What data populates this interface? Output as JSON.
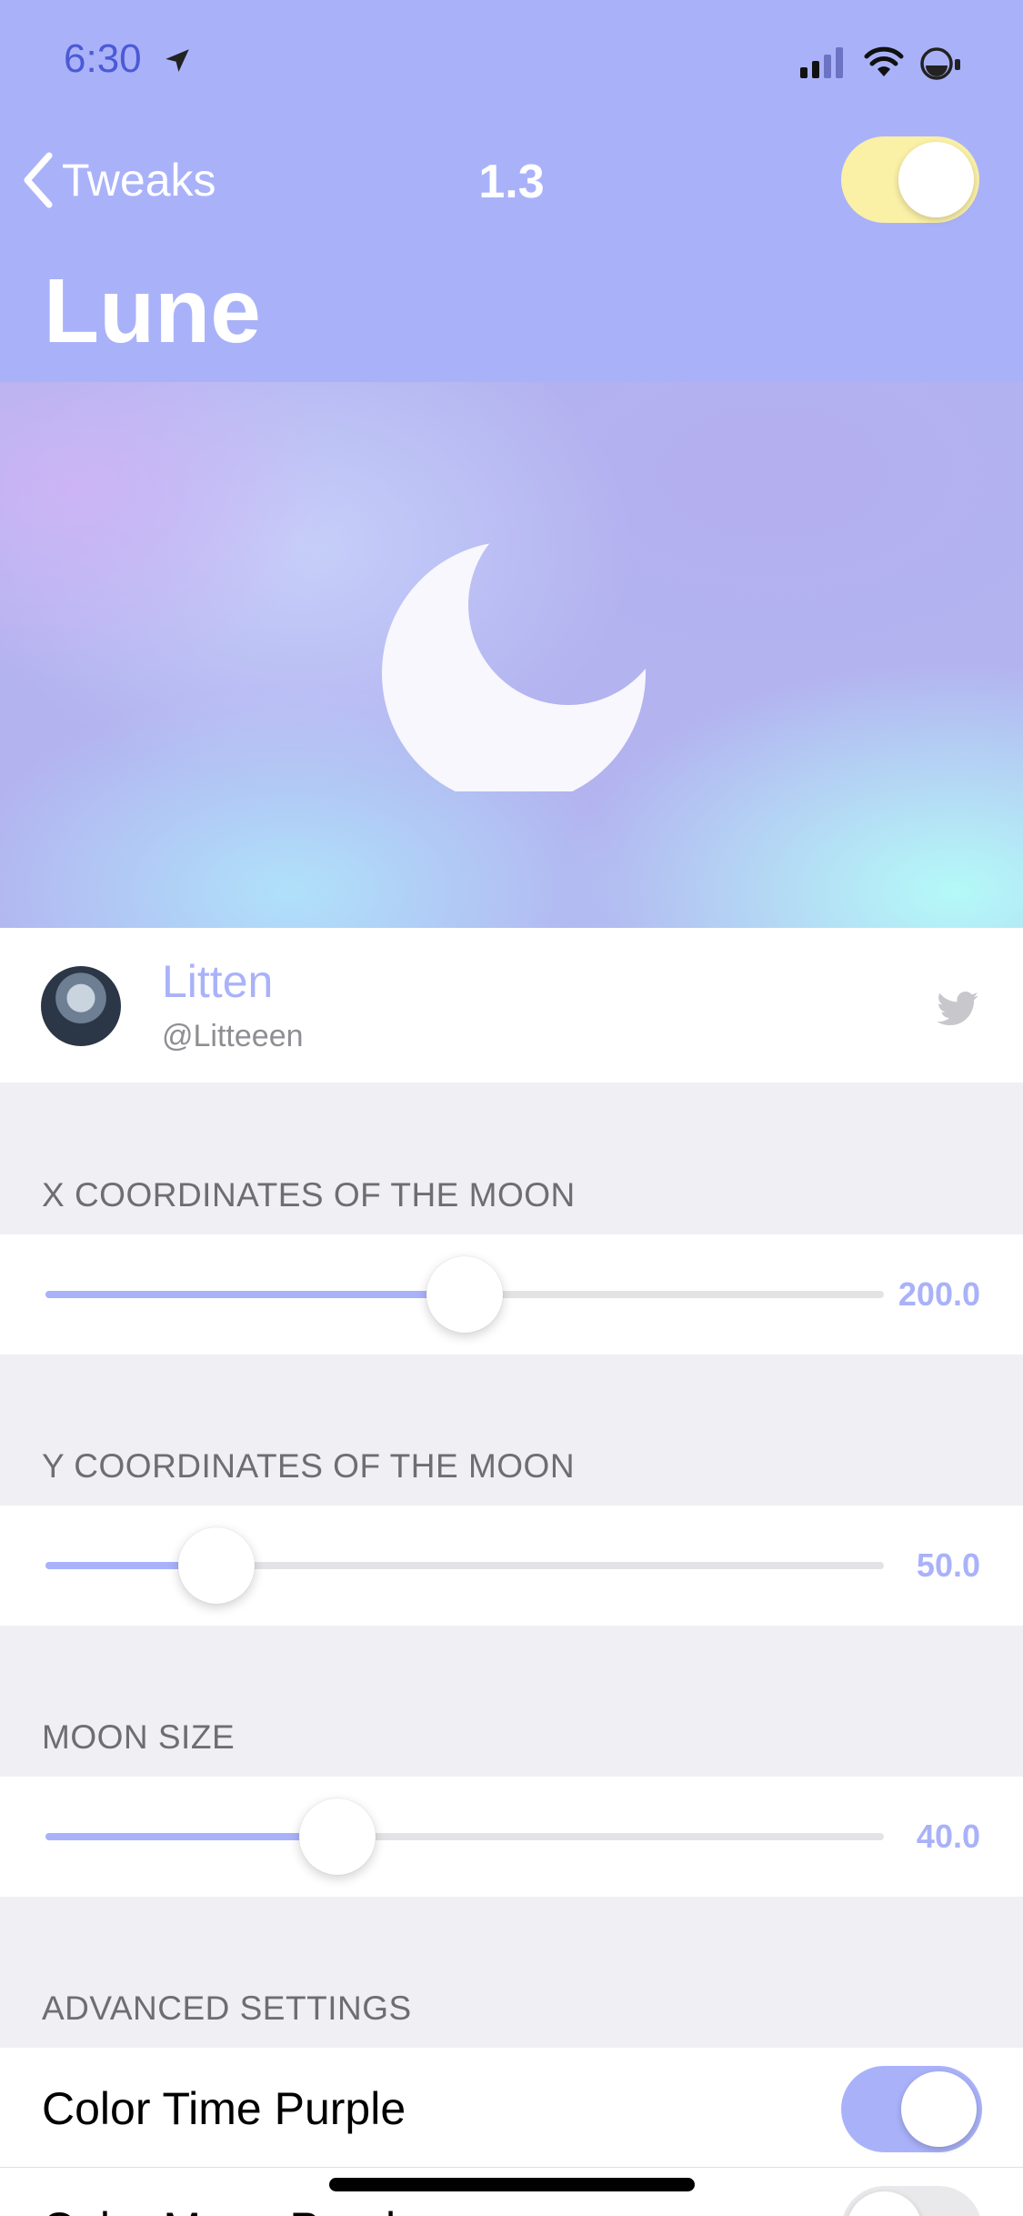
{
  "status_bar": {
    "time": "6:30"
  },
  "nav": {
    "back_label": "Tweaks",
    "version": "1.3",
    "enabled": true
  },
  "page": {
    "title": "Lune"
  },
  "author": {
    "name": "Litten",
    "handle": "@Litteeen"
  },
  "sliders": [
    {
      "header": "X COORDINATES OF THE MOON",
      "value_text": "200.0",
      "fraction": 0.5
    },
    {
      "header": "Y COORDINATES OF THE MOON",
      "value_text": "50.0",
      "fraction": 0.204
    },
    {
      "header": "MOON SIZE",
      "value_text": "40.0",
      "fraction": 0.348
    }
  ],
  "advanced": {
    "header": "ADVANCED SETTINGS",
    "items": [
      {
        "label": "Color Time Purple",
        "on": true
      },
      {
        "label": "Color Moon Purple",
        "on": false
      }
    ]
  },
  "colors": {
    "accent": "#a9b2f9",
    "toggle_on_header": "#faf0a6",
    "status_text": "#4c5ad6"
  },
  "icons": [
    "location-arrow-icon",
    "cellular-signal-icon",
    "wifi-icon",
    "battery-icon",
    "chevron-left-icon",
    "moon-icon",
    "twitter-icon"
  ]
}
